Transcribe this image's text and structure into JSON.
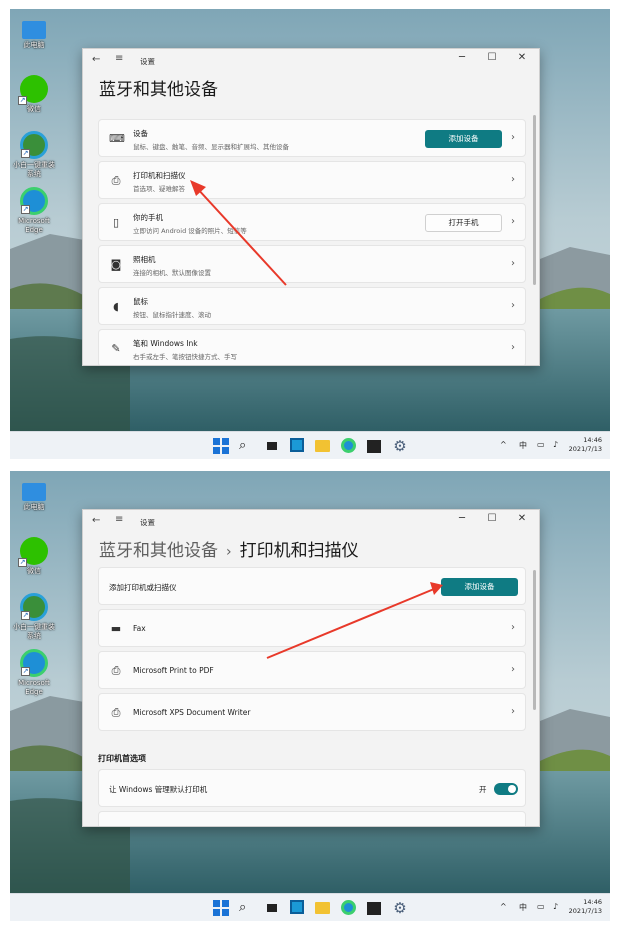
{
  "desktop": {
    "icons": [
      {
        "label": "此电脑"
      },
      {
        "label": "微信"
      },
      {
        "label": "小白一键重装系统"
      },
      {
        "label": "Microsoft Edge"
      }
    ]
  },
  "window1": {
    "app_title": "设置",
    "heading": "蓝牙和其他设备",
    "cards": [
      {
        "title": "设备",
        "subtitle": "鼠标、键盘、触笔、音频、显示器和扩展坞、其他设备",
        "button": "添加设备"
      },
      {
        "title": "打印机和扫描仪",
        "subtitle": "首选项、疑难解答"
      },
      {
        "title": "你的手机",
        "subtitle": "立即访问 Android 设备的照片、短信等",
        "button": "打开手机"
      },
      {
        "title": "照相机",
        "subtitle": "连接的相机、默认图像设置"
      },
      {
        "title": "鼠标",
        "subtitle": "按钮、鼠标指针速度、滚动"
      },
      {
        "title": "笔和 Windows Ink",
        "subtitle": "右手或左手、笔按钮快捷方式、手写"
      }
    ]
  },
  "window2": {
    "app_title": "设置",
    "breadcrumb_parent": "蓝牙和其他设备",
    "breadcrumb_sep": "›",
    "breadcrumb_current": "打印机和扫描仪",
    "add_row": {
      "label": "添加打印机或扫描仪",
      "button": "添加设备"
    },
    "printers": [
      {
        "name": "Fax"
      },
      {
        "name": "Microsoft Print to PDF"
      },
      {
        "name": "Microsoft XPS Document Writer"
      }
    ],
    "prefs_title": "打印机首选项",
    "default_printer": {
      "label": "让 Windows 管理默认打印机",
      "state": "开",
      "on": true
    }
  },
  "taskbar": {
    "tray": {
      "chevron": "^",
      "ime": "中"
    },
    "time": "14:46",
    "date": "2021/7/13"
  },
  "colors": {
    "accent": "#0f7b83",
    "arrow": "#e8392a"
  }
}
